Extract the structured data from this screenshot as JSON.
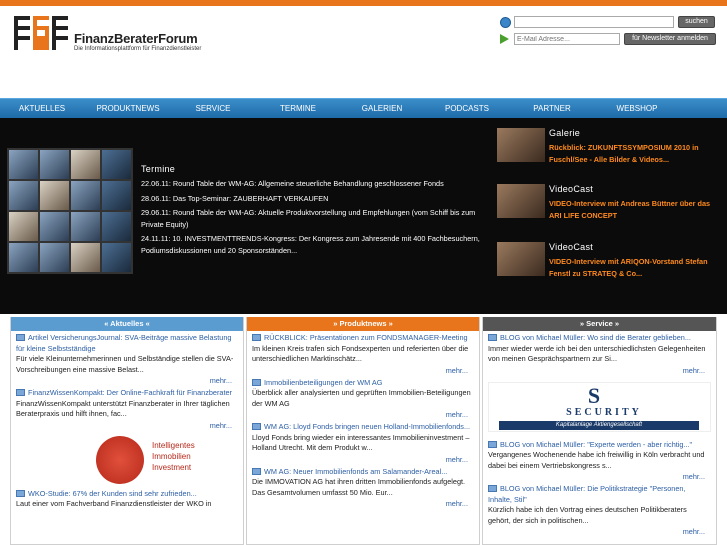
{
  "header": {
    "logo_name": "FinanzBeraterForum",
    "logo_tagline": "Die Informationsplattform für Finanzdienstleister",
    "search_button": "suchen",
    "email_placeholder": "E-Mail Adresse...",
    "newsletter_button": "für Newsletter anmelden"
  },
  "nav": [
    "AKTUELLES",
    "PRODUKTNEWS",
    "SERVICE",
    "TERMINE",
    "GALERIEN",
    "PODCASTS",
    "PARTNER",
    "WEBSHOP"
  ],
  "termine": {
    "title": "Termine",
    "items": [
      "22.06.11: Round Table der WM-AG: Allgemeine steuerliche Behandlung geschlossener Fonds",
      "28.06.11: Das Top-Seminar: ZAUBERHAFT VERKAUFEN",
      "29.06.11: Round Table der WM-AG: Aktuelle Produktvorstellung und Empfehlungen (vom Schiff bis zum Private Equity)",
      "24.11.11: 10. INVESTMENTTRENDS-Kongress: Der Kongress zum Jahresende mit 400 Fachbesuchern, Podiumsdiskussionen und 20 Sponsorständen..."
    ]
  },
  "side": [
    {
      "title": "Galerie",
      "text": "Rückblick: ZUKUNFTSSYMPOSIUM 2010 in Fuschl/See - Alle Bilder & Videos..."
    },
    {
      "title": "VideoCast",
      "text": "VIDEO-Interview mit Andreas Büttner über das ARI LIFE CONCEPT"
    },
    {
      "title": "VideoCast",
      "text": "VIDEO-Interview mit ARIQON-Vorstand Stefan Fenstl zu STRATEQ & Co..."
    }
  ],
  "columns": {
    "aktuelles": {
      "head": "« Aktuelles «",
      "items": [
        {
          "title": "Artikel VersicherungsJournal: SVA-Beiträge massive Belastung für kleine Selbstständige",
          "body": "Für viele Kleinunternehmerinnen und Selbständige stellen die SVA-Vorschreibungen eine massive Belast...",
          "more": "mehr..."
        },
        {
          "title": "FinanzWissenKompakt: Der Online-Fachkraft für Finanzberater",
          "body": "FinanzWissenKompakt unterstützt Finanzberater in Ihrer täglichen Beraterpraxis und hilft ihnen, fac...",
          "more": "mehr..."
        },
        {
          "title": "WKO-Studie: 67% der Kunden sind sehr zufrieden...",
          "body": "Laut einer vom Fachverband Finanzdienstleister der WKO in"
        }
      ],
      "ad_text": [
        "Intelligentes",
        "Immobilien",
        "Investment"
      ]
    },
    "produktnews": {
      "head": "» Produktnews »",
      "items": [
        {
          "title": "RÜCKBLICK: Präsentationen zum FONDSMANAGER-Meeting",
          "body": "Im kleinen Kreis trafen sich Fondsexperten und referierten über die unterschiedlichen Marktinschätz...",
          "more": "mehr..."
        },
        {
          "title": "Immobilienbeteiligungen der WM AG",
          "body": "Überblick aller analysierten und geprüften Immobilien-Beteiligungen der WM AG",
          "more": "mehr..."
        },
        {
          "title": "WM AG: Lloyd Fonds bringen neuen Holland-Immobilienfonds...",
          "body": "Lloyd Fonds bring wieder ein interessantes Immobilieninvestment – Holland Utrecht. Mit dem Produkt w...",
          "more": "mehr..."
        },
        {
          "title": "WM AG: Neuer Immobilienfonds am Salamander-Areal...",
          "body": "Die IMMOVATION AG hat ihren dritten Immobilienfonds aufgelegt. Das Gesamtvolumen umfasst 50 Mio. Eur...",
          "more": "mehr..."
        }
      ]
    },
    "service": {
      "head": "» Service »",
      "items": [
        {
          "title": "BLOG von Michael Müller: Wo sind die Berater geblieben...",
          "body": "Immer wieder werde ich bei den unterschiedlichsten Gelegenheiten von meinen Gesprächspartnern zur Si...",
          "more": "mehr..."
        },
        {
          "title": "BLOG von Michael Müller: \"Experte werden - aber richtig...\"",
          "body": "Vergangenes Wochenende habe ich freiwillig in Köln verbracht und dabei bei einem Vertriebskongress s...",
          "more": "mehr..."
        },
        {
          "title": "BLOG von Michael Müller: Die Politikstrategie \"Personen, Inhalte, Stil\"",
          "body": "Kürzlich habe ich den Vortrag eines deutschen Politikberaters gehört, der sich in politischen...",
          "more": "mehr..."
        }
      ],
      "ad": {
        "letter": "S",
        "name": "SECURITY",
        "sub": "Kapitalanlage Aktiengesellschaft"
      }
    }
  },
  "colors": {
    "orange": "#e8741c",
    "nav_blue": "#2a7bbb",
    "accent_orange": "#ff8a1e",
    "col_aktuelles": "#5a9bd0",
    "col_produktnews": "#e8741c",
    "col_service": "#555555"
  }
}
